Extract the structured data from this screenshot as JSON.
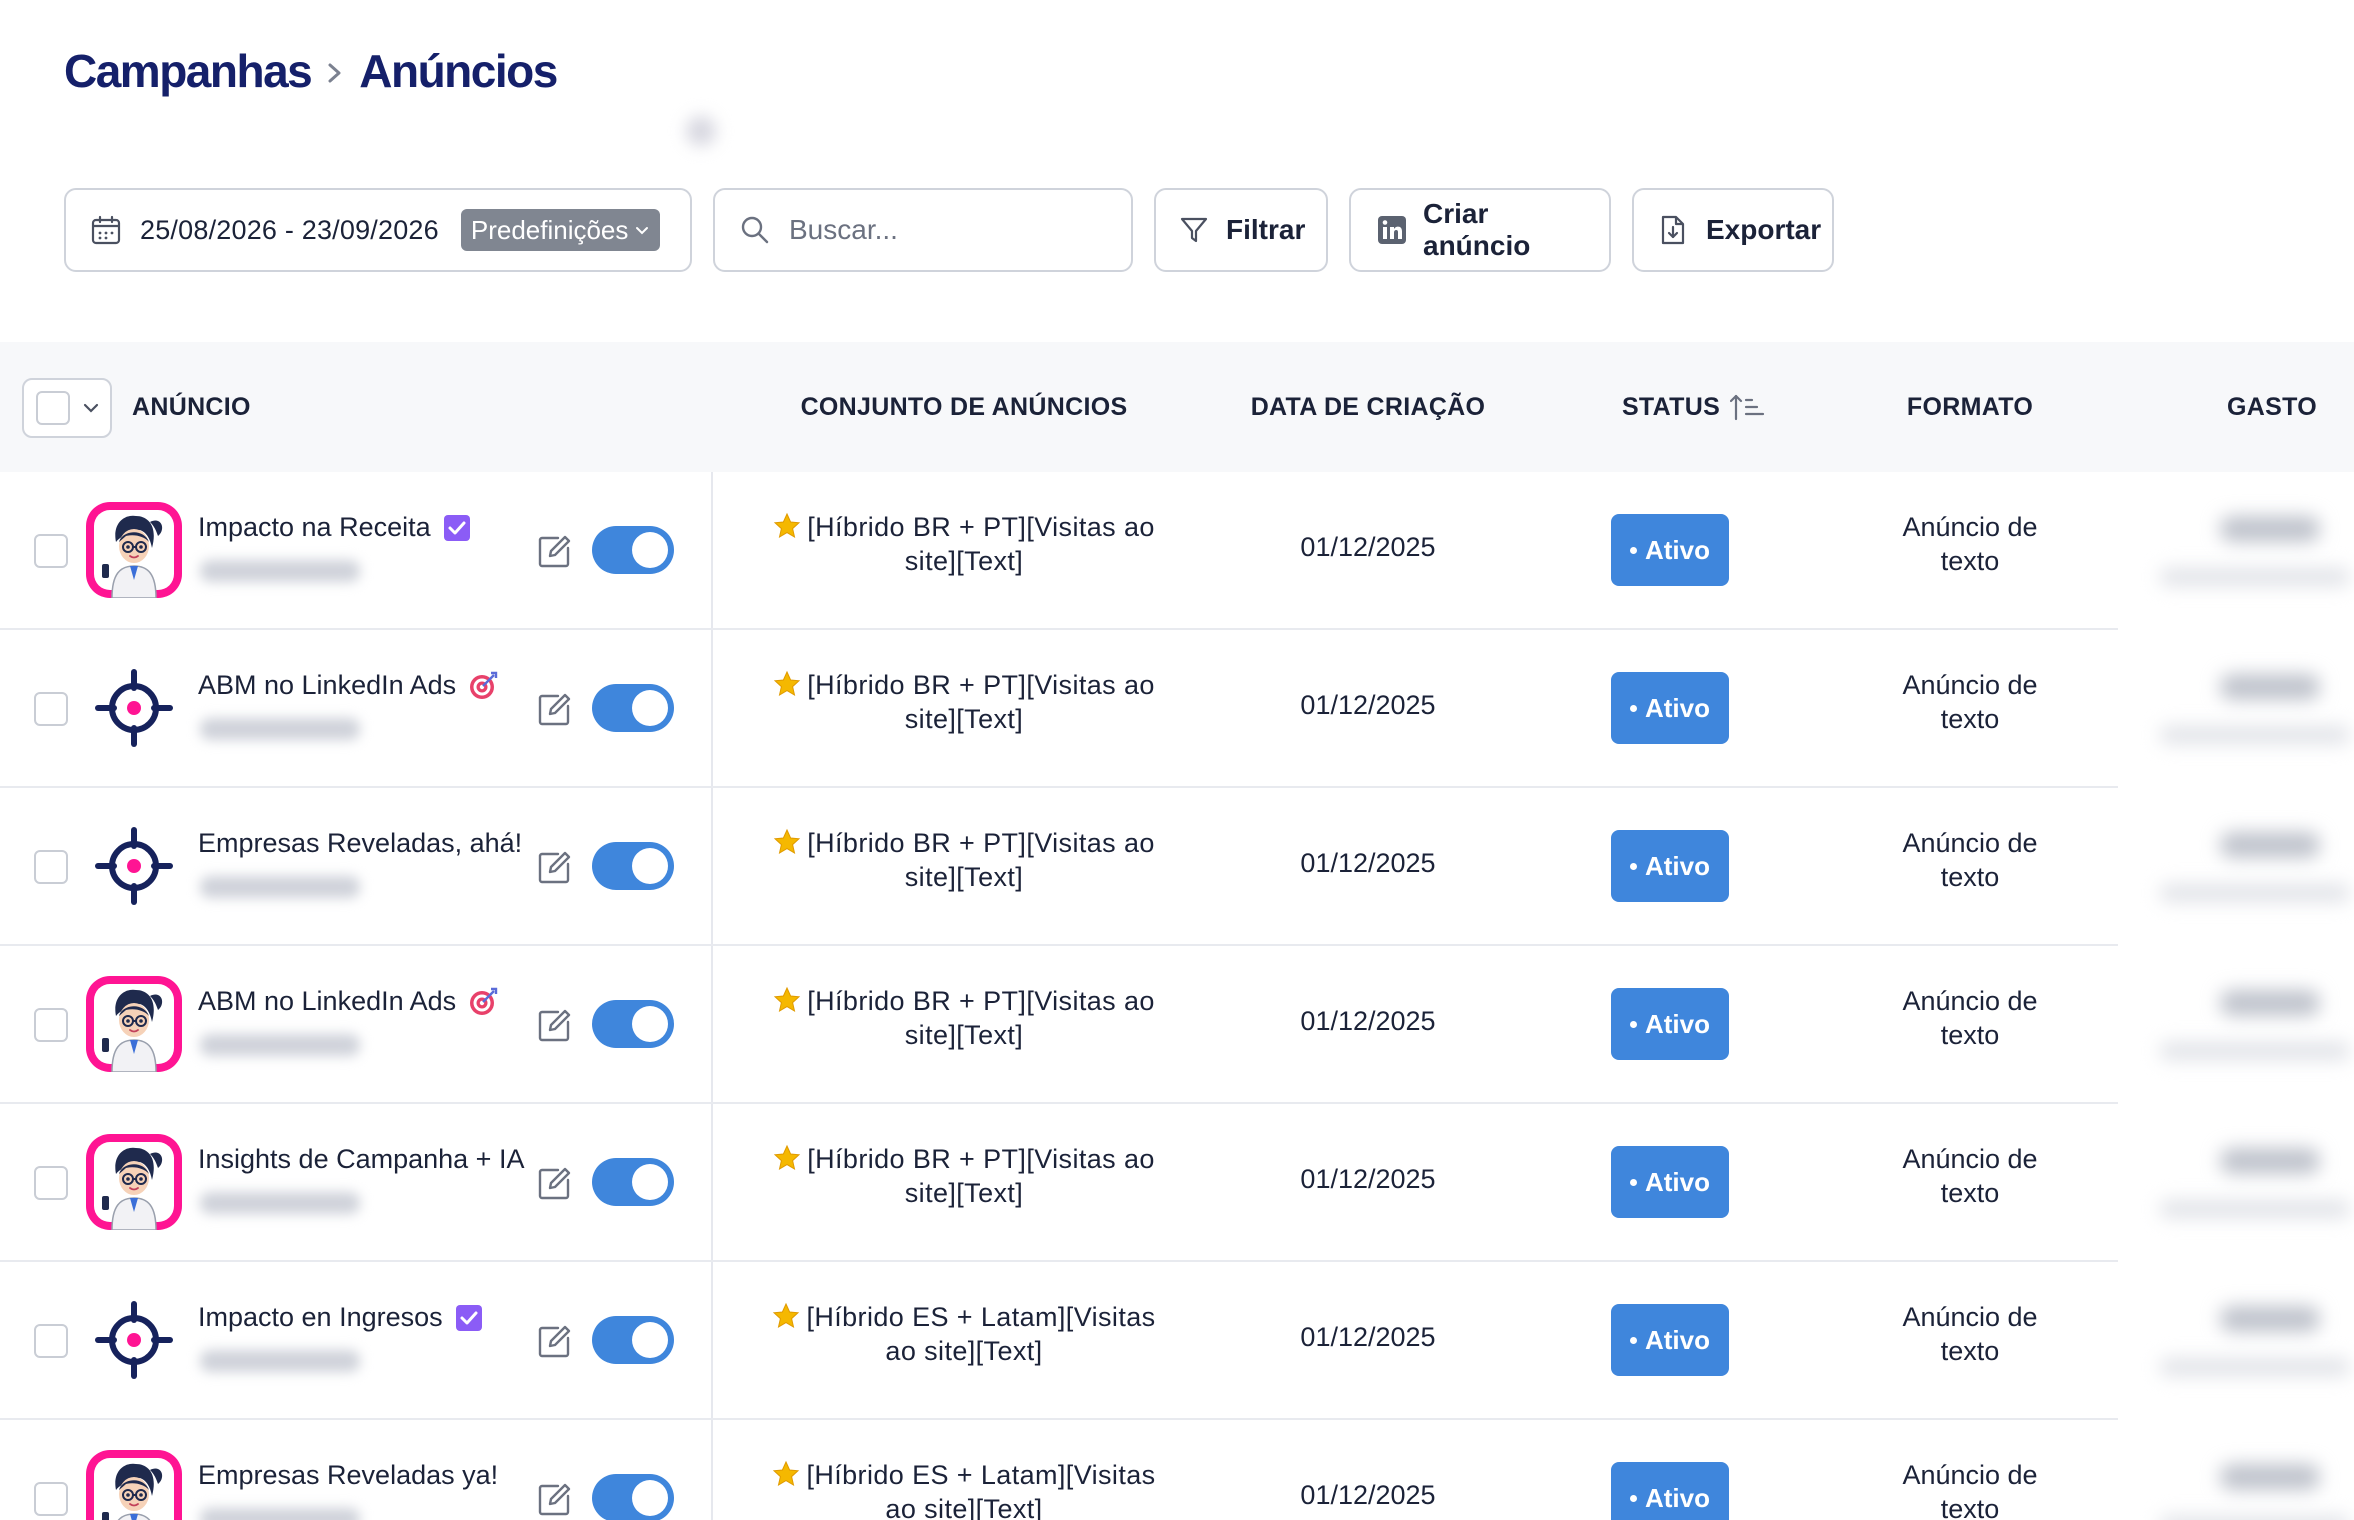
{
  "breadcrumb": {
    "root": "Campanhas",
    "current": "Anúncios"
  },
  "toolbar": {
    "date_range": "25/08/2026 - 23/09/2026",
    "presets_label": "Predefinições",
    "search_placeholder": "Buscar...",
    "filter_label": "Filtrar",
    "create_label": "Criar anúncio",
    "export_label": "Exportar"
  },
  "table": {
    "headers": {
      "ad": "ANÚNCIO",
      "adset": "CONJUNTO DE ANÚNCIOS",
      "created": "DATA DE CRIAÇÃO",
      "status": "STATUS",
      "format": "FORMATO",
      "spend": "GASTO"
    },
    "rows": [
      {
        "title": "Impacto na Receita",
        "badge": "check-badge",
        "thumb": "avatar",
        "adset_line1": "[Híbrido BR + PT][Visitas ao",
        "adset_line2": "site][Text]",
        "created": "01/12/2025",
        "status": "Ativo",
        "format_line1": "Anúncio de",
        "format_line2": "texto",
        "enabled": true
      },
      {
        "title": "ABM no LinkedIn Ads",
        "badge": "target-emoji",
        "thumb": "target",
        "adset_line1": "[Híbrido BR + PT][Visitas ao",
        "adset_line2": "site][Text]",
        "created": "01/12/2025",
        "status": "Ativo",
        "format_line1": "Anúncio de",
        "format_line2": "texto",
        "enabled": true
      },
      {
        "title": "Empresas Reveladas, ahá!",
        "badge": "",
        "thumb": "target",
        "adset_line1": "[Híbrido BR + PT][Visitas ao",
        "adset_line2": "site][Text]",
        "created": "01/12/2025",
        "status": "Ativo",
        "format_line1": "Anúncio de",
        "format_line2": "texto",
        "enabled": true
      },
      {
        "title": "ABM no LinkedIn Ads",
        "badge": "target-emoji",
        "thumb": "avatar",
        "adset_line1": "[Híbrido BR + PT][Visitas ao",
        "adset_line2": "site][Text]",
        "created": "01/12/2025",
        "status": "Ativo",
        "format_line1": "Anúncio de",
        "format_line2": "texto",
        "enabled": true
      },
      {
        "title": "Insights de Campanha + IA",
        "badge": "",
        "thumb": "avatar",
        "adset_line1": "[Híbrido BR + PT][Visitas ao",
        "adset_line2": "site][Text]",
        "created": "01/12/2025",
        "status": "Ativo",
        "format_line1": "Anúncio de",
        "format_line2": "texto",
        "enabled": true
      },
      {
        "title": "Impacto en Ingresos",
        "badge": "check-badge",
        "thumb": "target",
        "adset_line1": "[Híbrido ES + Latam][Visitas",
        "adset_line2": "ao site][Text]",
        "created": "01/12/2025",
        "status": "Ativo",
        "format_line1": "Anúncio de",
        "format_line2": "texto",
        "enabled": true
      },
      {
        "title": "Empresas Reveladas ya!",
        "badge": "",
        "thumb": "avatar",
        "adset_line1": "[Híbrido ES + Latam][Visitas",
        "adset_line2": "ao site][Text]",
        "created": "01/12/2025",
        "status": "Ativo",
        "format_line1": "Anúncio de",
        "format_line2": "texto",
        "enabled": true
      }
    ]
  },
  "colors": {
    "brand_navy": "#15206a",
    "status_active": "#3f86dc",
    "avatar_bg": "#ff1493",
    "badge_purple": "#8b5cf6"
  }
}
